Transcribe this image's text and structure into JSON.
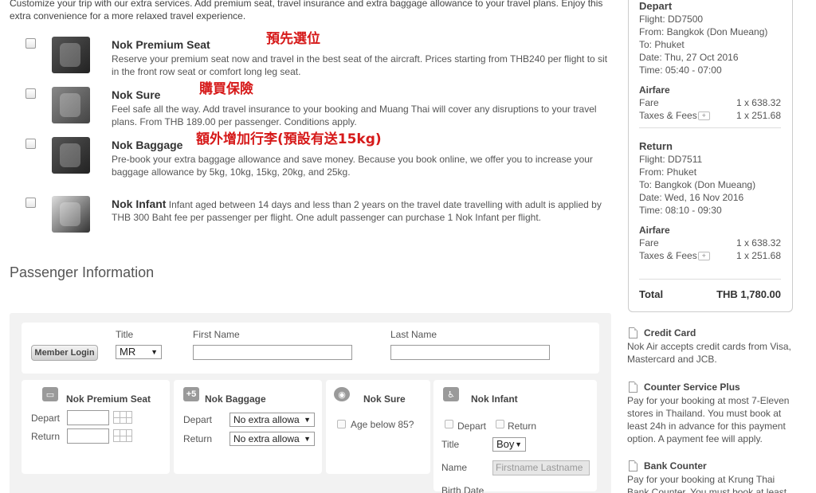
{
  "intro": "Customize your trip with our extra services. Add premium seat, travel insurance and extra baggage allowance to your travel plans. Enjoy this extra convenience for a more relaxed travel experience.",
  "extras": [
    {
      "title": "Nok Premium Seat",
      "annotation": "預先選位",
      "desc": "Reserve your premium seat now and travel in the best seat of the aircraft. Prices starting from THB240 per flight to sit in the front row seat or comfort long leg seat."
    },
    {
      "title": "Nok Sure",
      "annotation": "購買保險",
      "desc": "Feel safe all the way. Add travel insurance to your booking and Muang Thai will cover any disruptions to your travel plans. From THB 189.00 per passenger. Conditions apply."
    },
    {
      "title": "Nok Baggage",
      "annotation": "額外增加行李(預設有送15kg)",
      "desc": "Pre-book your extra baggage allowance and save money. Because you book online, we offer you to increase your baggage allowance by 5kg, 10kg, 15kg, 20kg, and 25kg."
    },
    {
      "title": "Nok Infant",
      "annotation": "",
      "desc": "Infant aged between 14 days and less than 2 years on the travel date travelling with adult is applied by THB 300 Baht fee per passenger per flight. One adult passenger can purchase 1 Nok Infant per flight."
    }
  ],
  "passenger": {
    "section_title": "Passenger Information",
    "member_login": "Member Login",
    "title_label": "Title",
    "title_value": "MR",
    "first_name_label": "First Name",
    "last_name_label": "Last Name",
    "premium_seat": {
      "heading": "Nok Premium Seat",
      "depart": "Depart",
      "return": "Return"
    },
    "baggage": {
      "heading": "Nok Baggage",
      "icon_text": "+5",
      "depart": "Depart",
      "return": "Return",
      "depart_value": "No extra allowa",
      "return_value": "No extra allowa"
    },
    "sure": {
      "heading": "Nok Sure",
      "age_label": "Age below 85?"
    },
    "infant": {
      "heading": "Nok Infant",
      "depart": "Depart",
      "return": "Return",
      "title_label": "Title",
      "title_value": "Boy",
      "name_label": "Name",
      "name_placeholder": "Firstname Lastname",
      "birth_label": "Birth Date"
    }
  },
  "summary": {
    "depart": {
      "heading": "Depart",
      "flight": "Flight: DD7500",
      "from": "From:  Bangkok (Don Mueang)",
      "to": "To:     Phuket",
      "date": "Date:  Thu, 27 Oct 2016",
      "time": "Time:  05:40 - 07:00"
    },
    "depart_airfare": {
      "heading": "Airfare",
      "fare_label": "Fare",
      "fare_value": "1 x 638.32",
      "tax_label": "Taxes & Fees",
      "tax_value": "1 x 251.68"
    },
    "return": {
      "heading": "Return",
      "flight": "Flight: DD7511",
      "from": "From:  Phuket",
      "to": "To:     Bangkok (Don Mueang)",
      "date": "Date:  Wed, 16 Nov 2016",
      "time": "Time:  08:10 - 09:30"
    },
    "return_airfare": {
      "heading": "Airfare",
      "fare_label": "Fare",
      "fare_value": "1 x 638.32",
      "tax_label": "Taxes & Fees",
      "tax_value": "1 x 251.68"
    },
    "total_label": "Total",
    "total_value": "THB 1,780.00"
  },
  "payments": [
    {
      "title": "Credit Card",
      "desc": "Nok Air accepts credit cards from Visa, Mastercard and JCB."
    },
    {
      "title": "Counter Service Plus",
      "desc": "Pay for your booking at most 7-Eleven stores in Thailand. You must book at least 24h in advance for this payment option. A payment fee will apply."
    },
    {
      "title": "Bank Counter",
      "desc": "Pay for your booking at Krung Thai Bank Counter. You must book at least"
    }
  ]
}
